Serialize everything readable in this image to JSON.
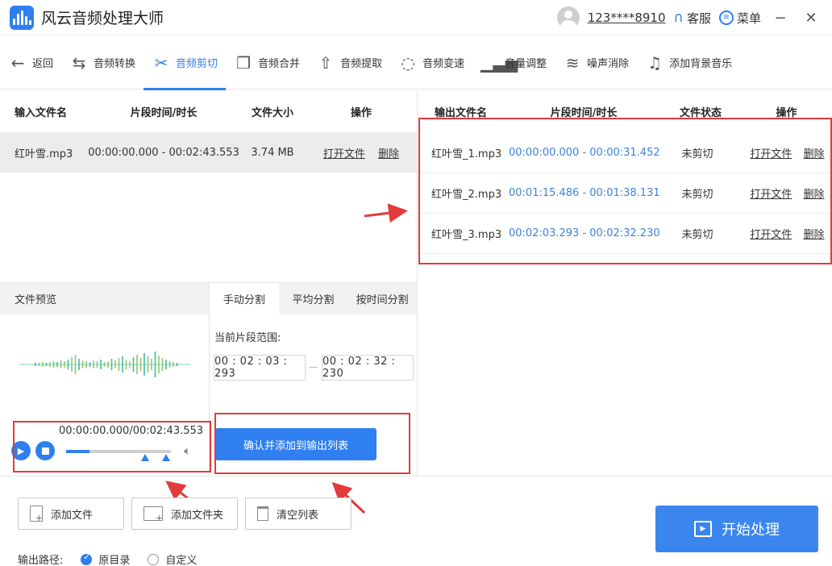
{
  "title_bar": {
    "app_title": "风云音频处理大师",
    "user": "123****8910",
    "service_label": "客服",
    "menu_label": "菜单",
    "minimize": "−",
    "close": "✕"
  },
  "toolbar": {
    "back": "返回",
    "items": [
      {
        "label": "音频转换",
        "icon": "convert-icon"
      },
      {
        "label": "音频剪切",
        "icon": "scissors-icon"
      },
      {
        "label": "音频合并",
        "icon": "merge-icon"
      },
      {
        "label": "音频提取",
        "icon": "extract-icon"
      },
      {
        "label": "音频变速",
        "icon": "speed-icon"
      },
      {
        "label": "音量调整",
        "icon": "volume-bars-icon"
      },
      {
        "label": "噪声消除",
        "icon": "noise-icon"
      },
      {
        "label": "添加背景音乐",
        "icon": "music-note-icon"
      }
    ],
    "active_index": 1,
    "accent": "#2f7ff0"
  },
  "input_table": {
    "headers": [
      "输入文件名",
      "片段时间/时长",
      "文件大小",
      "操作"
    ],
    "row": {
      "name": "红叶雪.mp3",
      "time": "00:00:00.000 - 00:02:43.553",
      "size": "3.74 MB",
      "open": "打开文件",
      "delete": "删除"
    }
  },
  "output_table": {
    "headers": [
      "输出文件名",
      "片段时间/时长",
      "文件状态",
      "操作"
    ],
    "rows": [
      {
        "name": "红叶雪_1.mp3",
        "time": "00:00:00.000 - 00:00:31.452",
        "status": "未剪切",
        "open": "打开文件",
        "delete": "删除"
      },
      {
        "name": "红叶雪_2.mp3",
        "time": "00:01:15.486 - 00:01:38.131",
        "status": "未剪切",
        "open": "打开文件",
        "delete": "删除"
      },
      {
        "name": "红叶雪_3.mp3",
        "time": "00:02:03.293 - 00:02:32.230",
        "status": "未剪切",
        "open": "打开文件",
        "delete": "删除"
      }
    ]
  },
  "preview": {
    "label": "文件预览",
    "player_time": "00:00:00.000/00:02:43.553",
    "progress": 0.22
  },
  "split_tabs": {
    "tabs": [
      "手动分割",
      "平均分割",
      "按时间分割"
    ],
    "active_index": 0,
    "range_label": "当前片段范围:",
    "start": "00 : 02 : 03 : 293",
    "end": "00 : 02 : 32 : 230",
    "confirm": "确认并添加到输出列表"
  },
  "bottom": {
    "add_file": "添加文件",
    "add_folder": "添加文件夹",
    "clear_list": "清空列表",
    "start": "开始处理",
    "output_path_label": "输出路径:",
    "option_original": "原目录",
    "option_custom": "自定义"
  }
}
